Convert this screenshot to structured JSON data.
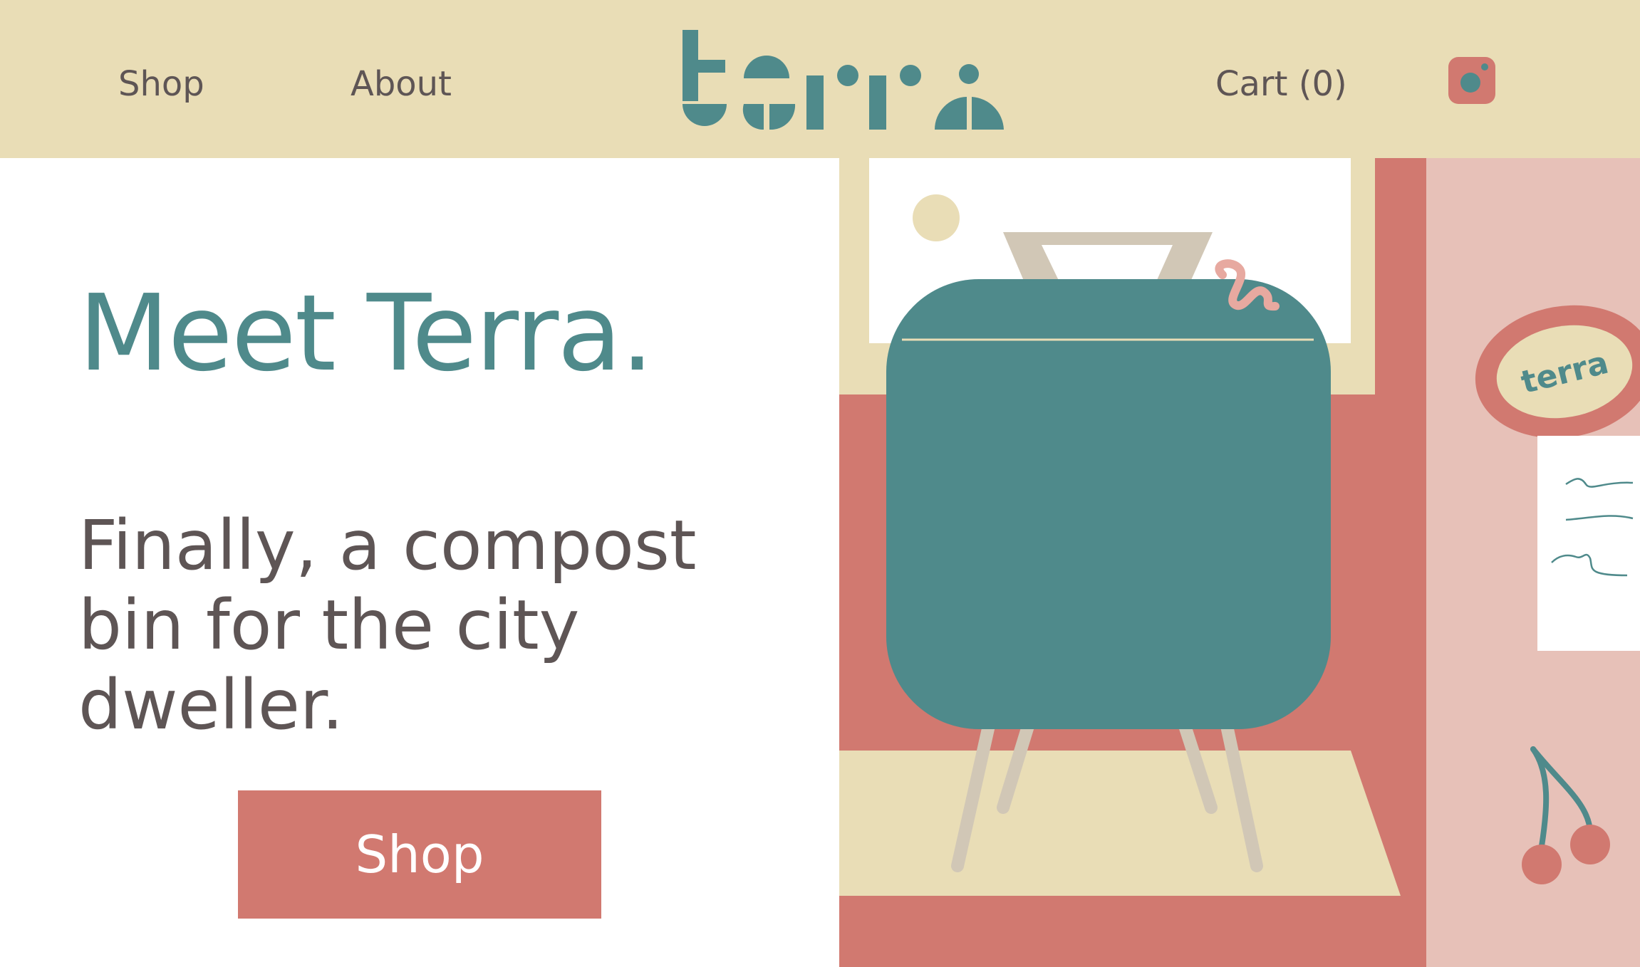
{
  "nav": {
    "shop_label": "Shop",
    "about_label": "About",
    "cart_label": "Cart (0)",
    "logo_text": "terra",
    "social_icon": "instagram-icon"
  },
  "hero": {
    "title": "Meet Terra.",
    "subtitle": "Finally, a compost bin for the city dweller.",
    "button_label": "Shop"
  },
  "illustration": {
    "sign_text": "terra",
    "icons": [
      "compost-bin-illustration",
      "worm-icon",
      "cherries-icon",
      "sun-icon"
    ]
  },
  "colors": {
    "sand": "#e9ddb6",
    "teal": "#4f8a8b",
    "coral": "#d17970",
    "blush": "#e7c1b8",
    "text": "#5e5555",
    "tan": "#d1c7b6"
  }
}
